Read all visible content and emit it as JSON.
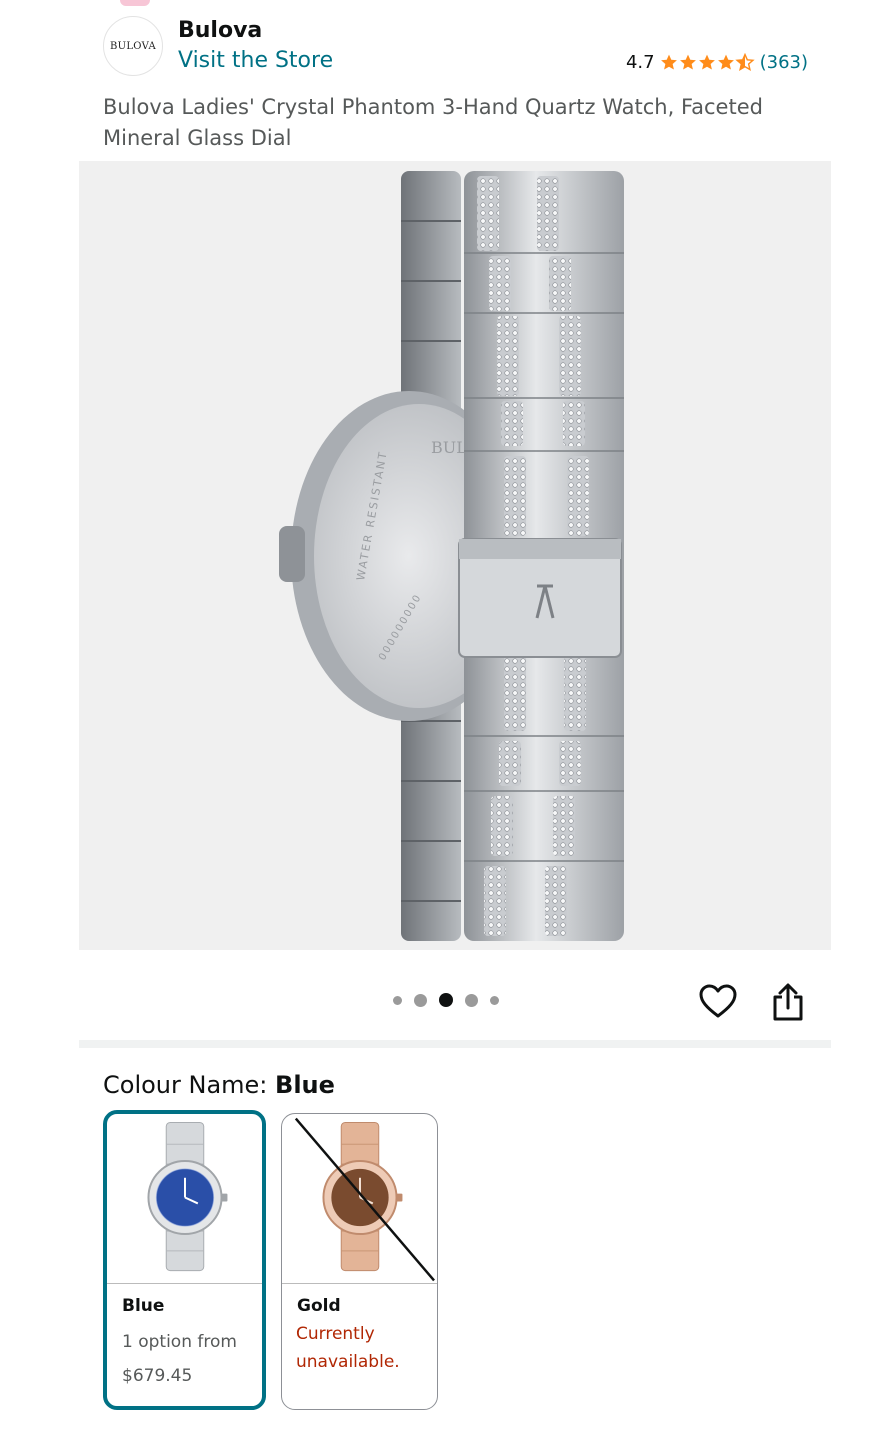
{
  "brand": {
    "logo_text": "BULOVA",
    "name": "Bulova",
    "store_link": "Visit the Store"
  },
  "rating": {
    "value": "4.7",
    "stars": 4.5,
    "count": "(363)"
  },
  "product": {
    "title": "Bulova Ladies' Crystal Phantom 3-Hand Quartz Watch, Faceted Mineral Glass Dial",
    "image_watermark": [
      "BULO",
      "WATER RESISTANT",
      "000000000"
    ]
  },
  "carousel": {
    "total": 5,
    "active_index": 2
  },
  "actions": {
    "wishlist_icon": "heart-icon",
    "share_icon": "share-icon"
  },
  "colour": {
    "label": "Colour Name: ",
    "selected": "Blue",
    "options": [
      {
        "name": "Blue",
        "subtitle": "1 option from",
        "price": "$679.45",
        "available": true,
        "dial_color": "#2a4fa8",
        "band_color": "#d6d9dc"
      },
      {
        "name": "Gold",
        "status": "Currently unavailable.",
        "available": false,
        "dial_color": "#7a4b2f",
        "band_color": "#d9a486"
      }
    ]
  },
  "colors": {
    "link": "#007185",
    "star": "#FF8C1A",
    "unavailable": "#B12704",
    "selected_border": "#007185"
  }
}
